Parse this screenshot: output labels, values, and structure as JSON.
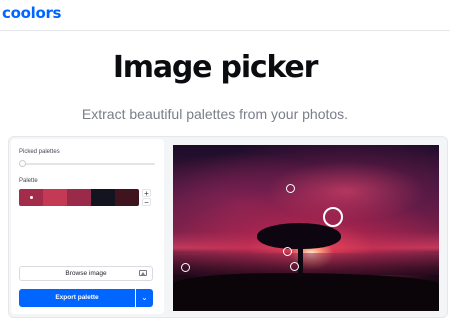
{
  "app": {
    "logo": "coolors"
  },
  "hero": {
    "title": "Image picker",
    "subtitle": "Extract beautiful palettes from your photos."
  },
  "panel": {
    "picked_label": "Picked palettes",
    "picked_value": 0,
    "palette_label": "Palette",
    "palette": [
      {
        "color": "#a42c4b",
        "selected": true
      },
      {
        "color": "#c43a55",
        "selected": false
      },
      {
        "color": "#9a2a49",
        "selected": false
      },
      {
        "color": "#12141f",
        "selected": false
      },
      {
        "color": "#40141f",
        "selected": false
      }
    ],
    "stepper": {
      "plus": "+",
      "minus": "−"
    },
    "browse_label": "Browse image",
    "export_label": "Export palette"
  },
  "colors": {
    "accent": "#0066ff"
  },
  "icons": [
    "image-icon",
    "chevron-down-icon",
    "plus-icon",
    "minus-icon"
  ]
}
